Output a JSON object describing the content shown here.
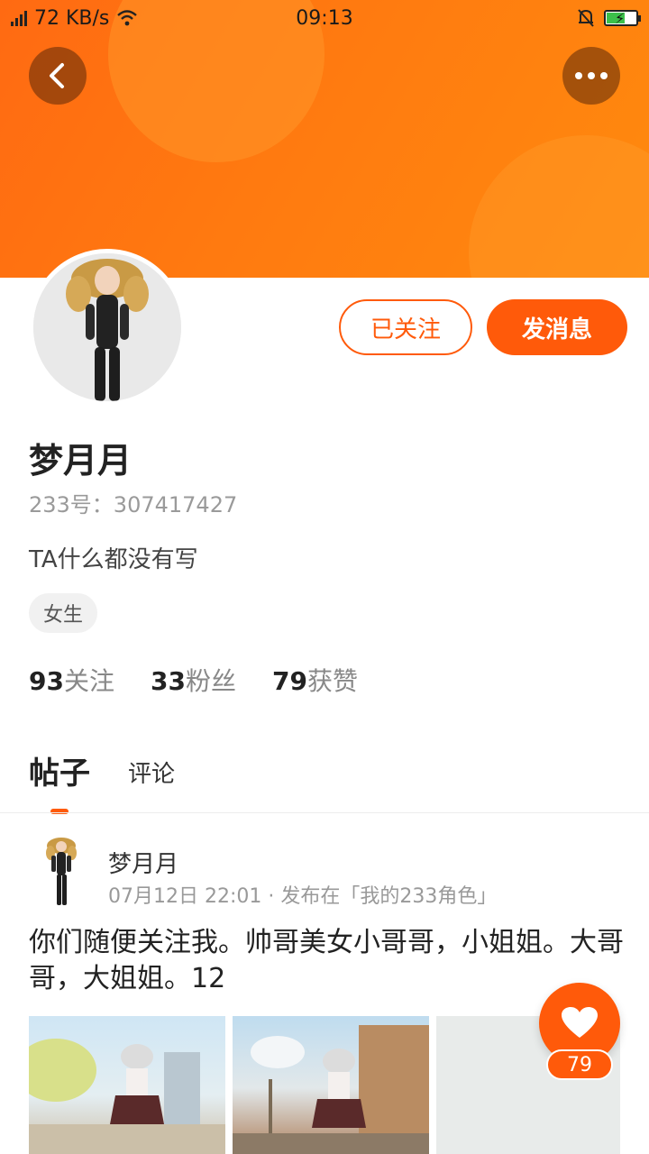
{
  "statusbar": {
    "net_speed": "72 KB/s",
    "time": "09:13",
    "icons": [
      "signal-icon",
      "wifi-icon",
      "bell-off-icon",
      "battery-charging-icon"
    ]
  },
  "header": {
    "back_icon": "chevron-left-icon",
    "more_icon": "more-horizontal-icon",
    "banner_color": "#ff7010"
  },
  "profile": {
    "name": "梦月月",
    "uid": "233号：307417427",
    "bio": "TA什么都没有写",
    "gender_tag": "女生",
    "following_button": "已关注",
    "message_button": "发消息"
  },
  "stats": [
    {
      "num": "93",
      "label": "关注"
    },
    {
      "num": "33",
      "label": "粉丝"
    },
    {
      "num": "79",
      "label": "获赞"
    }
  ],
  "tabs": [
    {
      "label": "帖子",
      "active": true
    },
    {
      "label": "评论",
      "active": false
    }
  ],
  "post": {
    "author": "梦月月",
    "meta": "07月12日 22:01 · 发布在「我的233角色」",
    "text": "你们随便关注我。帅哥美女小哥哥，小姐姐。大哥哥，大姐姐。12"
  },
  "like": {
    "icon": "heart-icon",
    "count": "79"
  },
  "colors": {
    "accent": "#ff5a0a",
    "muted": "#999999"
  }
}
